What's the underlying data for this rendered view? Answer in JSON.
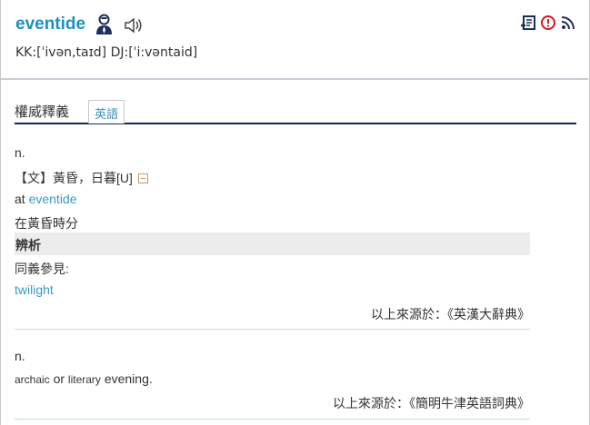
{
  "header": {
    "word": "eventide",
    "pronunciation": "KK:[ˈivən,taɪd] DJ:[ˈi:vəntaid]",
    "icons": [
      "person-icon",
      "speaker-icon",
      "add-wordbook-icon",
      "report-icon",
      "rss-icon"
    ]
  },
  "tabs": {
    "section_title": "權威釋義",
    "english_tab": "英語"
  },
  "entry1": {
    "pos": "n.",
    "definition": "【文】黃昏，日暮[U]",
    "example_prefix": "at ",
    "example_link": "eventide",
    "example_translation": "在黃昏時分",
    "analysis_label": "辨析",
    "synonym_label": "同義參見:",
    "synonym_link": "twilight",
    "source": "以上來源於：《英漢大辭典》"
  },
  "entry2": {
    "pos": "n.",
    "archaic": "archaic",
    "or": " or ",
    "literary": "literary",
    "meaning": " evening.",
    "source": "以上來源於：《簡明牛津英語詞典》"
  },
  "colors": {
    "accent": "#1f8fc0",
    "link": "#3a9ac6",
    "tab_underline": "#14285a",
    "divider": "#b5dde8",
    "icon_red": "#d0191c",
    "icon_navy": "#1b2f5e"
  }
}
